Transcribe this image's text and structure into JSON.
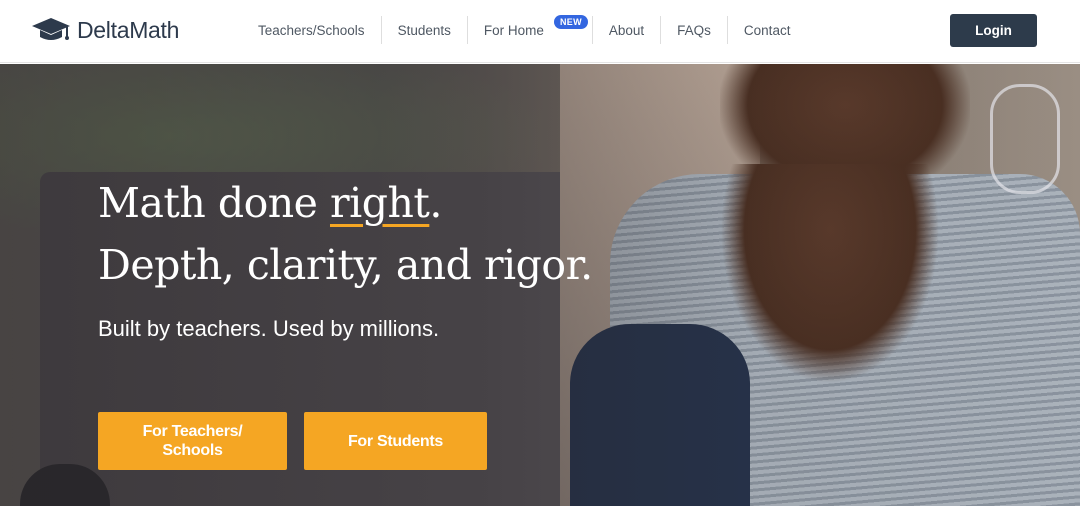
{
  "brand": {
    "name": "DeltaMath",
    "icon": "graduation-cap-icon",
    "color": "#2d3a4c"
  },
  "nav": {
    "items": [
      {
        "label": "Teachers/Schools"
      },
      {
        "label": "Students"
      },
      {
        "label": "For Home",
        "badge": "NEW"
      },
      {
        "label": "About"
      },
      {
        "label": "FAQs"
      },
      {
        "label": "Contact"
      }
    ],
    "login_label": "Login"
  },
  "hero": {
    "headline_line1_start": "Math done ",
    "headline_line1_emphasis": "right",
    "headline_line1_end": ".",
    "headline_line2": "Depth, clarity, and rigor.",
    "subline": "Built by teachers. Used by millions.",
    "cta_teachers_line1": "For Teachers/",
    "cta_teachers_line2": "Schools",
    "cta_students": "For Students"
  },
  "colors": {
    "accent": "#f5a623",
    "login_bg": "#2d3b4b",
    "badge_bg": "#3366e0"
  }
}
